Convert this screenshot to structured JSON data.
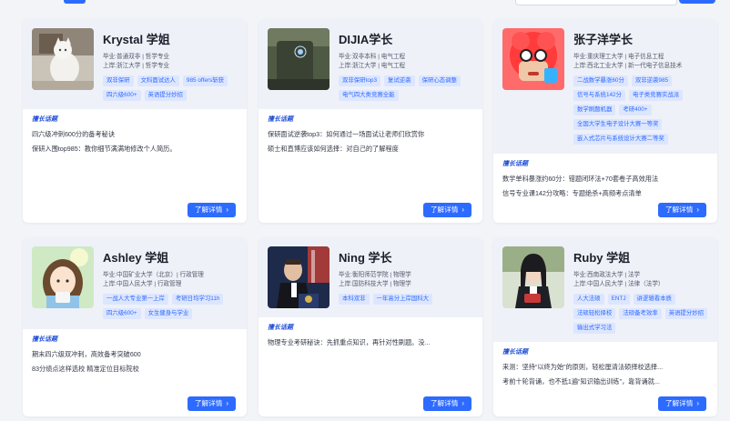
{
  "topic_label": "擅长话题",
  "button_label": "了解详情",
  "cards": [
    {
      "name": "Krystal 学姐",
      "meta": [
        "毕业:普通双非 | 哲学专业",
        "上岸:浙江大学 | 哲学专业"
      ],
      "tags": [
        "双非保研",
        "文科面试达人",
        "985 offers斩获",
        "四六级600+",
        "英语提分妙招"
      ],
      "topics": [
        "四六级冲刺600分的备考秘诀",
        "保研入围top985：教你细节满满地修改个人简历。"
      ]
    },
    {
      "name": "DIJIA学长",
      "meta": [
        "毕业:双非本科 | 电气工程",
        "上岸:浙江大学 | 电气工程"
      ],
      "tags": [
        "双非保研top3",
        "复试逆袭",
        "保研心态调整",
        "电气四大类竞赛全能"
      ],
      "topics": [
        "保研面试逆袭top3：如何通过一场面试让老师们欣赏你",
        "硕士和直博应该如何选择：对自己的了解程度"
      ]
    },
    {
      "name": "张子洋学长",
      "meta": [
        "毕业:重庆理工大学 | 电子信息工程",
        "上岸:西北工业大学 | 新一代电子信息技术"
      ],
      "tags": [
        "二战数学暴涨60分",
        "双非逆袭985",
        "信号与系统142分",
        "电子类竞赛实战派",
        "数学刷题机器",
        "考研400+",
        "全国大学生电子设计大赛一等奖",
        "嵌入式芯片与系统设计大赛二等奖"
      ],
      "topics": [
        "数学单科暴涨约60分：错题闭环法+70套卷子高效用法",
        "信号专业课142分攻略：专题绝杀+高频考点清单"
      ]
    },
    {
      "name": "Ashley 学姐",
      "meta": [
        "毕业:中国矿业大学（北京）| 行政管理",
        "上岸:中国人民大学 | 行政管理"
      ],
      "tags": [
        "一战人大专业第一上岸",
        "考研日均学习11h",
        "四六级600+",
        "女生健身与学业"
      ],
      "topics": [
        "期末四六级双冲刺，高效备考突破600",
        "83分绩点这样选校 精准定位目标院校"
      ]
    },
    {
      "name": "Ning 学长",
      "meta": [
        "毕业:衡阳师范学院 | 物理学",
        "上岸:国防科技大学 | 物理学"
      ],
      "tags": [
        "本科双非",
        "一年高分上岸国科大"
      ],
      "topics": [
        "物理专业考研秘诀：先抓重点知识，再针对性刷题。没..."
      ]
    },
    {
      "name": "Ruby 学姐",
      "meta": [
        "毕业:西南政法大学 | 法学",
        "上岸:中国人民大学 | 法律（法学）"
      ],
      "tags": [
        "人大法硕",
        "ENTJ",
        "讲逻辑看本质",
        "法硕轻松择校",
        "法硕备考效率",
        "英语提分妙招",
        "输出式学习法"
      ],
      "topics": [
        "来测：坚持“以终为始”的原则，轻松厘清法硕择校选择...",
        "考前十轮背诵，也不抵1遍“知识输出训练”，靠背诵就..."
      ]
    }
  ]
}
